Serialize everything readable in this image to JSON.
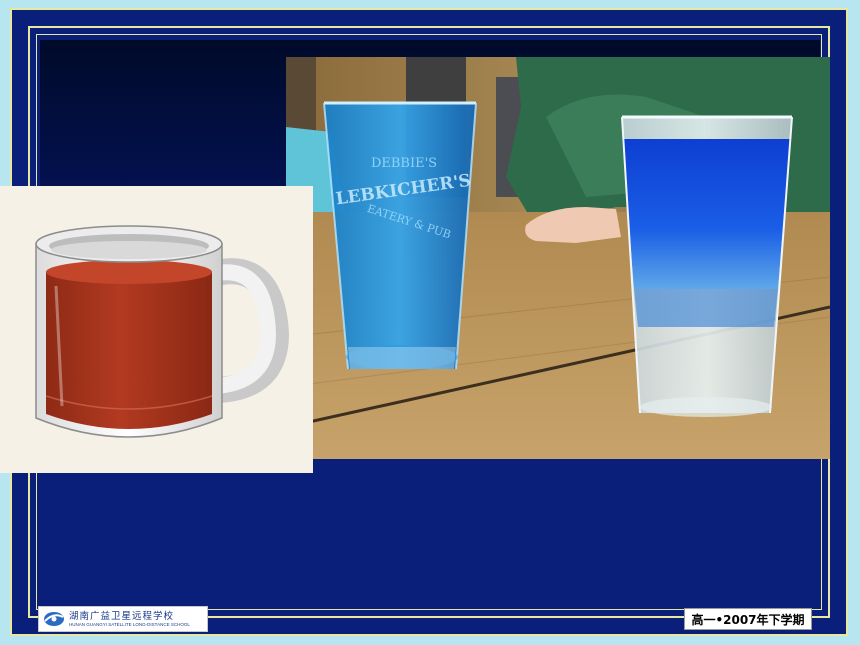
{
  "footer": {
    "school_name": "湖南广益卫星远程学校",
    "school_name_en": "HUNAN GUANGYI SATELLITE LONG-DISTANCE SCHOOL",
    "term": "高一•2007年下学期"
  },
  "photo": {
    "glass_print_top": "DEBBIE'S",
    "glass_print_main": "LEBKICHER'S",
    "glass_print_sub": "EATERY & PUB"
  },
  "colors": {
    "slide_bg": "#0a1f7a",
    "border": "#e8e8a0",
    "liquid_blue": "#1e7fd0",
    "tea": "#a8331c"
  }
}
